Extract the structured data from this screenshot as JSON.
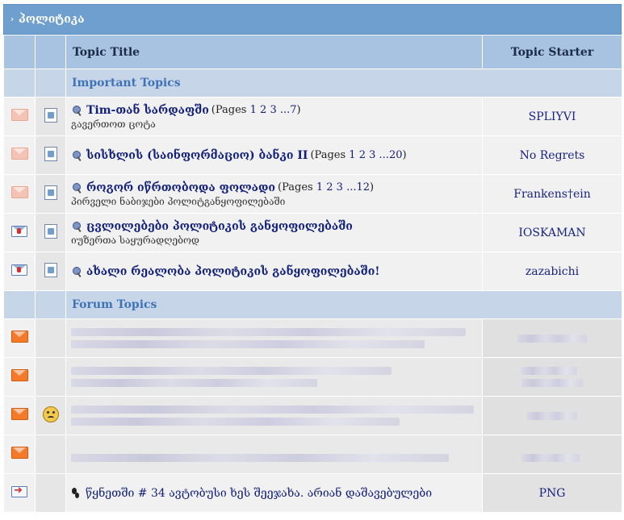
{
  "forum": {
    "title": "პოლიტიკა",
    "headers": {
      "topic_title": "Topic Title",
      "topic_starter": "Topic Starter"
    },
    "sections": {
      "important": "Important Topics",
      "forum": "Forum Topics"
    },
    "important_topics": [
      {
        "title": "Tim-თან სარდაფში",
        "pages_prefix": "(Pages",
        "pages": [
          "1",
          "2",
          "3",
          "...7"
        ],
        "pages_suffix": ")",
        "description": "გავერთოთ ცოტა",
        "starter": "SPLIYVI",
        "status_icon": "envelope-read-icon"
      },
      {
        "title": "სისხლის (საინფორმაციო) ბანკი II",
        "pages_prefix": "(Pages",
        "pages": [
          "1",
          "2",
          "3",
          "...20"
        ],
        "pages_suffix": ")",
        "description": "",
        "starter": "No Regrets",
        "status_icon": "envelope-read-icon"
      },
      {
        "title": "როგორ იწრთობოდა ფოლადი",
        "pages_prefix": "(Pages",
        "pages": [
          "1",
          "2",
          "3",
          "...12"
        ],
        "pages_suffix": ")",
        "description": "პირველი ნაბიჯები პოლიტგანყოფილებაში",
        "starter": "Frankens†ein",
        "status_icon": "envelope-read-icon"
      },
      {
        "title": "ცვლილებები პოლიტიკის განყოფილებაში",
        "pages_prefix": "",
        "pages": [],
        "pages_suffix": "",
        "description": "იუზერთა საყურადღებოდ",
        "starter": "IOSKAMAN",
        "status_icon": "envelope-locked-icon"
      },
      {
        "title": "ახალი რეალობა პოლიტიკის განყოფილებაში!",
        "pages_prefix": "",
        "pages": [],
        "pages_suffix": "",
        "description": "",
        "starter": "zazabichi",
        "status_icon": "envelope-locked-icon"
      }
    ],
    "last_topic": {
      "title": "წყნეთში # 34 ავტობუსი ხეს შეეჯახა. არიან დაშავებულები",
      "starter": "PNG",
      "status_icon": "moved-topic-icon"
    }
  }
}
